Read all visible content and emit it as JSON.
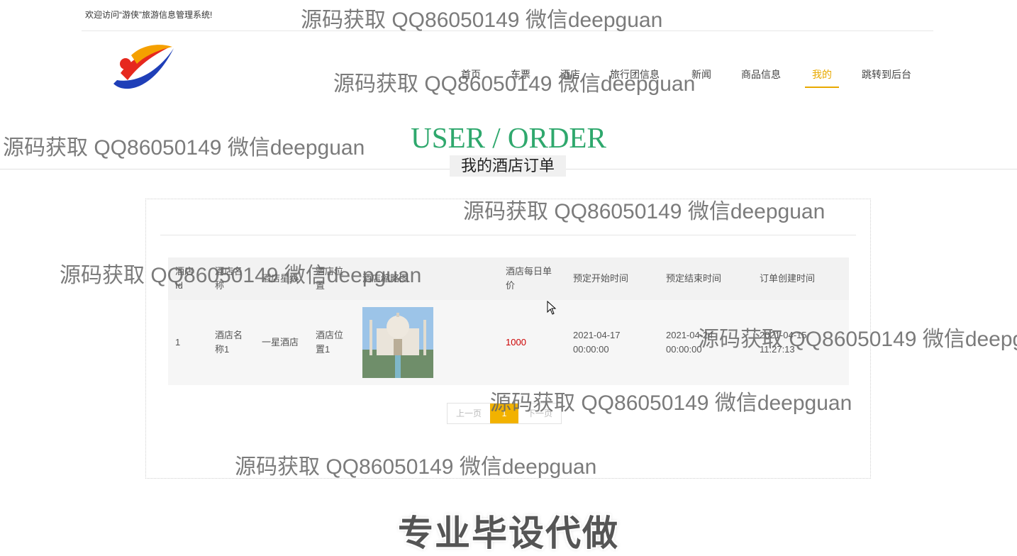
{
  "header": {
    "welcome": "欢迎访问“游侠”旅游信息管理系统!"
  },
  "nav": {
    "items": [
      "首页",
      "车票",
      "酒店",
      "旅行团信息",
      "新闻",
      "商品信息",
      "我的",
      "跳转到后台"
    ],
    "active": "我的"
  },
  "page": {
    "title_en": "USER / ORDER",
    "title_cn": "我的酒店订单"
  },
  "table": {
    "headers": [
      "酒店Id",
      "酒店名称",
      "酒店星级",
      "酒店位置",
      "酒店缩略图",
      "酒店每日单价",
      "预定开始时间",
      "预定结束时间",
      "订单创建时间"
    ],
    "rows": [
      {
        "id": "1",
        "name": "酒店名称1",
        "star": "一星酒店",
        "location": "酒店位置1",
        "thumbnail": "hotel-thumbnail",
        "price": "1000",
        "start": "2021-04-17 00:00:00",
        "end": "2021-04-24 00:00:00",
        "created": "2021-04-15 11:27:13"
      }
    ]
  },
  "pagination": {
    "prev": "上一页",
    "current": "1",
    "next": "下一页"
  },
  "watermarks": {
    "text": "源码获取 QQ86050149 微信deepguan",
    "banner": "专业毕设代做"
  },
  "colors": {
    "accent": "#e8a900",
    "title_green": "#2fa86d",
    "price_red": "#cc0000",
    "pager_active": "#f2b200"
  }
}
